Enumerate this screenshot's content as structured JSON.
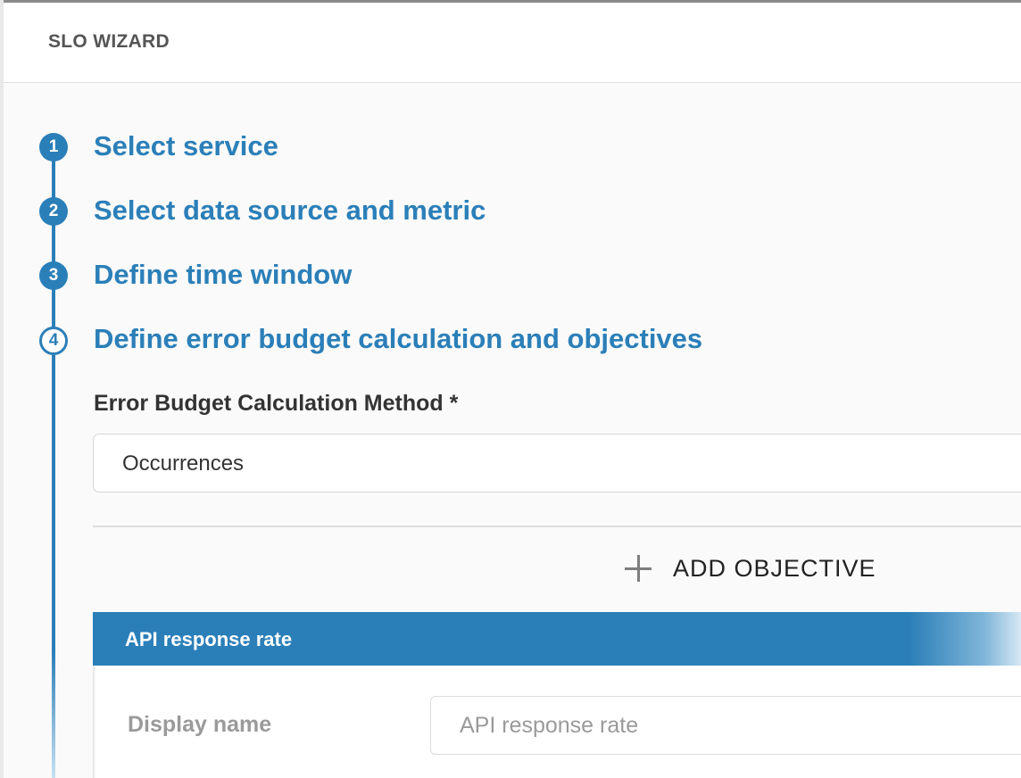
{
  "header": {
    "title": "SLO WIZARD"
  },
  "steps": [
    {
      "number": "1",
      "label": "Select service",
      "state": "completed"
    },
    {
      "number": "2",
      "label": "Select data source and metric",
      "state": "completed"
    },
    {
      "number": "3",
      "label": "Define time window",
      "state": "completed"
    },
    {
      "number": "4",
      "label": "Define error budget calculation and objectives",
      "state": "active"
    }
  ],
  "error_budget": {
    "label": "Error Budget Calculation Method *",
    "selected_value": "Occurrences"
  },
  "add_objective": {
    "label": "ADD OBJECTIVE",
    "icon": "plus-icon"
  },
  "objective": {
    "title": "API response rate",
    "display_name_label": "Display name",
    "display_name_placeholder": "API response rate"
  },
  "colors": {
    "accent": "#2b7fb8",
    "header_text": "#555555",
    "muted_text": "#9a9a9a"
  }
}
